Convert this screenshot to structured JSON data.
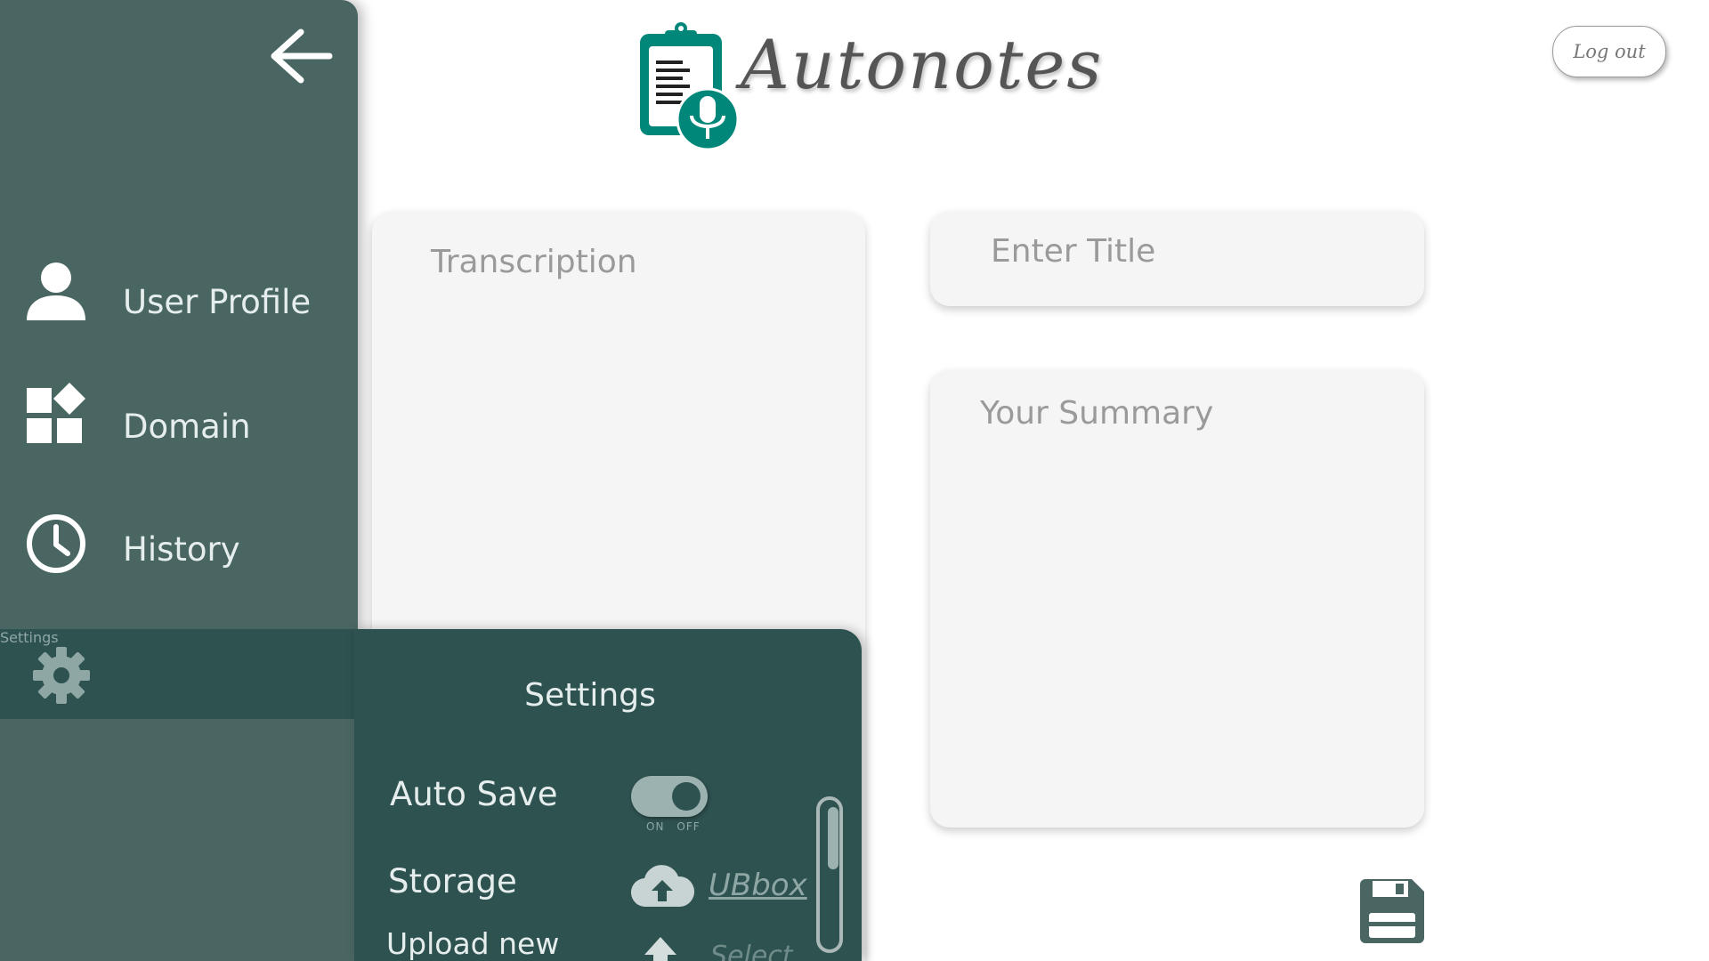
{
  "app": {
    "title": "Autonotes",
    "accent_color": "#00877a"
  },
  "header": {
    "logout_label": "Log out"
  },
  "sidebar": {
    "back_icon": "arrow-left-icon",
    "items": [
      {
        "label": "User Profile",
        "icon": "user-icon"
      },
      {
        "label": "Domain",
        "icon": "widgets-icon"
      },
      {
        "label": "History",
        "icon": "clock-icon"
      },
      {
        "label": "Settings",
        "icon": "gear-icon",
        "active": true
      }
    ]
  },
  "settings_panel": {
    "title": "Settings",
    "auto_save": {
      "label": "Auto Save",
      "state": "on",
      "caption_on": "ON",
      "caption_off": "OFF"
    },
    "storage": {
      "label": "Storage",
      "icon": "cloud-upload-icon",
      "value": "UBbox"
    },
    "upload": {
      "label": "Upload new",
      "icon": "upload-arrow-icon",
      "action": "Select"
    }
  },
  "main": {
    "transcription_placeholder": "Transcription",
    "title_placeholder": "Enter Title",
    "summary_placeholder": "Your Summary",
    "save_icon": "floppy-disk-icon"
  }
}
